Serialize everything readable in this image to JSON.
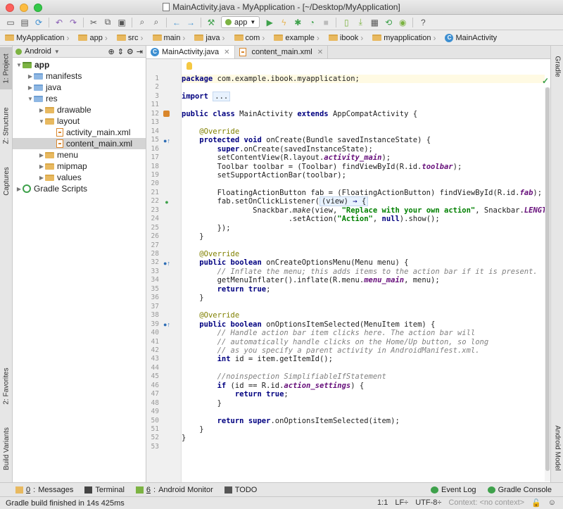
{
  "window": {
    "title": "MainActivity.java - MyApplication - [~/Desktop/MyApplication]"
  },
  "toolbar": {
    "run_config": "app",
    "icons": [
      "open-icon",
      "save-icon",
      "sync-icon",
      "undo-icon",
      "redo-icon",
      "cut-icon",
      "copy-icon",
      "paste-icon",
      "find-icon",
      "replace-icon",
      "back-icon",
      "forward-icon",
      "build-icon",
      "run-config-icon",
      "run-icon",
      "apply-changes-icon",
      "debug-icon",
      "profile-icon",
      "stop-icon",
      "avd-icon",
      "sdk-icon",
      "structure-icon",
      "sync-gradle-icon",
      "monitor-icon",
      "help-icon"
    ]
  },
  "breadcrumbs": [
    "MyApplication",
    "app",
    "src",
    "main",
    "java",
    "com",
    "example",
    "ibook",
    "myapplication",
    "MainActivity"
  ],
  "left_tabs": [
    "1: Project",
    "Z: Structure",
    "Captures",
    "2: Favorites",
    "Build Variants"
  ],
  "right_tabs": [
    "Gradle",
    "Android Model"
  ],
  "project": {
    "view": "Android",
    "tree": [
      {
        "label": "app",
        "depth": 0,
        "kind": "module",
        "expanded": true
      },
      {
        "label": "manifests",
        "depth": 1,
        "kind": "folder",
        "expanded": false
      },
      {
        "label": "java",
        "depth": 1,
        "kind": "folder",
        "expanded": false
      },
      {
        "label": "res",
        "depth": 1,
        "kind": "folder",
        "expanded": true
      },
      {
        "label": "drawable",
        "depth": 2,
        "kind": "folder",
        "expanded": false
      },
      {
        "label": "layout",
        "depth": 2,
        "kind": "folder",
        "expanded": true
      },
      {
        "label": "activity_main.xml",
        "depth": 3,
        "kind": "xml"
      },
      {
        "label": "content_main.xml",
        "depth": 3,
        "kind": "xml",
        "selected": true
      },
      {
        "label": "menu",
        "depth": 2,
        "kind": "folder",
        "expanded": false
      },
      {
        "label": "mipmap",
        "depth": 2,
        "kind": "folder",
        "expanded": false
      },
      {
        "label": "values",
        "depth": 2,
        "kind": "folder",
        "expanded": false
      },
      {
        "label": "Gradle Scripts",
        "depth": 0,
        "kind": "gradle",
        "expanded": false
      }
    ]
  },
  "editor_tabs": [
    {
      "label": "MainActivity.java",
      "active": true
    },
    {
      "label": "content_main.xml",
      "active": false
    }
  ],
  "code": [
    {
      "n": "1",
      "html": "<span class=\"kw\">package</span> com.example.ibook.myapplication;"
    },
    {
      "n": "2",
      "html": ""
    },
    {
      "n": "3",
      "html": "<span class=\"kw\">import</span> <span class=\"fold-txt\">...</span>"
    },
    {
      "n": "11",
      "html": ""
    },
    {
      "n": "12",
      "html": "<span class=\"kw\">public class</span> MainActivity <span class=\"kw\">extends</span> AppCompatActivity {",
      "mark": "class"
    },
    {
      "n": "13",
      "html": ""
    },
    {
      "n": "14",
      "html": "    <span class=\"ann\">@Override</span>"
    },
    {
      "n": "15",
      "html": "    <span class=\"kw\">protected void</span> onCreate(Bundle savedInstanceState) {",
      "mark": "override"
    },
    {
      "n": "16",
      "html": "        <span class=\"kw\">super</span>.onCreate(savedInstanceState);"
    },
    {
      "n": "17",
      "html": "        setContentView(R.layout.<span class=\"fld\">activity_main</span>);"
    },
    {
      "n": "18",
      "html": "        Toolbar toolbar = (Toolbar) findViewById(R.id.<span class=\"fld\">toolbar</span>);"
    },
    {
      "n": "19",
      "html": "        setSupportActionBar(toolbar);"
    },
    {
      "n": "20",
      "html": ""
    },
    {
      "n": "21",
      "html": "        FloatingActionButton fab = (FloatingActionButton) findViewById(R.id.<span class=\"fld\">fab</span>);"
    },
    {
      "n": "22",
      "html": "        fab.setOnClickListener(<span class=\"fold-txt\">(view) <span class=\"lambda\">→</span> {</span>",
      "mark": "green"
    },
    {
      "n": "23",
      "html": "                Snackbar.<i>make</i>(view, <span class=\"str\">\"Replace with your own action\"</span>, Snackbar.<span class=\"fld\">LENGTH_LONG</span>)"
    },
    {
      "n": "24",
      "html": "                        .setAction(<span class=\"str\">\"Action\"</span>, <span class=\"kw\">null</span>).show();"
    },
    {
      "n": "25",
      "html": "        });"
    },
    {
      "n": "26",
      "html": "    }"
    },
    {
      "n": "27",
      "html": ""
    },
    {
      "n": "28",
      "html": "    <span class=\"ann\">@Override</span>"
    },
    {
      "n": "32",
      "html": "    <span class=\"kw\">public boolean</span> onCreateOptionsMenu(Menu menu) {",
      "mark": "override"
    },
    {
      "n": "33",
      "html": "        <span class=\"cm\">// Inflate the menu; this adds items to the action bar if it is present.</span>"
    },
    {
      "n": "34",
      "html": "        getMenuInflater().inflate(R.menu.<span class=\"fld\">menu_main</span>, menu);"
    },
    {
      "n": "35",
      "html": "        <span class=\"kw\">return true</span>;"
    },
    {
      "n": "36",
      "html": "    }"
    },
    {
      "n": "37",
      "html": ""
    },
    {
      "n": "38",
      "html": "    <span class=\"ann\">@Override</span>"
    },
    {
      "n": "39",
      "html": "    <span class=\"kw\">public boolean</span> onOptionsItemSelected(MenuItem item) {",
      "mark": "override"
    },
    {
      "n": "40",
      "html": "        <span class=\"cm\">// Handle action bar item clicks here. The action bar will</span>"
    },
    {
      "n": "41",
      "html": "        <span class=\"cm\">// automatically handle clicks on the Home/Up button, so long</span>"
    },
    {
      "n": "42",
      "html": "        <span class=\"cm\">// as you specify a parent activity in AndroidManifest.xml.</span>"
    },
    {
      "n": "43",
      "html": "        <span class=\"kw\">int</span> id = item.getItemId();"
    },
    {
      "n": "44",
      "html": ""
    },
    {
      "n": "45",
      "html": "        <span class=\"cm\">//noinspection SimplifiableIfStatement</span>"
    },
    {
      "n": "46",
      "html": "        <span class=\"kw\">if</span> (id == R.id.<span class=\"fld\">action_settings</span>) {"
    },
    {
      "n": "47",
      "html": "            <span class=\"kw\">return true</span>;"
    },
    {
      "n": "48",
      "html": "        }"
    },
    {
      "n": "49",
      "html": ""
    },
    {
      "n": "50",
      "html": "        <span class=\"kw\">return super</span>.onOptionsItemSelected(item);"
    },
    {
      "n": "51",
      "html": "    }"
    },
    {
      "n": "52",
      "html": "}"
    },
    {
      "n": "53",
      "html": ""
    }
  ],
  "bottom_tools": {
    "left": [
      {
        "num": "0",
        "label": "Messages",
        "icon": "messages-icon",
        "color": "#e8b960"
      },
      {
        "num": "",
        "label": "Terminal",
        "icon": "terminal-icon",
        "color": "#444444"
      },
      {
        "num": "6",
        "label": "Android Monitor",
        "icon": "android-icon",
        "color": "#7cb342"
      },
      {
        "num": "",
        "label": "TODO",
        "icon": "todo-icon",
        "color": "#555555"
      }
    ],
    "right": [
      {
        "label": "Event Log",
        "icon": "event-log-icon",
        "color": "#3ea14b"
      },
      {
        "label": "Gradle Console",
        "icon": "gradle-console-icon",
        "color": "#3ea14b"
      }
    ]
  },
  "status": {
    "message": "Gradle build finished in 14s 425ms",
    "position": "1:1",
    "line_sep": "LF÷",
    "encoding": "UTF-8÷",
    "context": "Context: <no context>"
  }
}
